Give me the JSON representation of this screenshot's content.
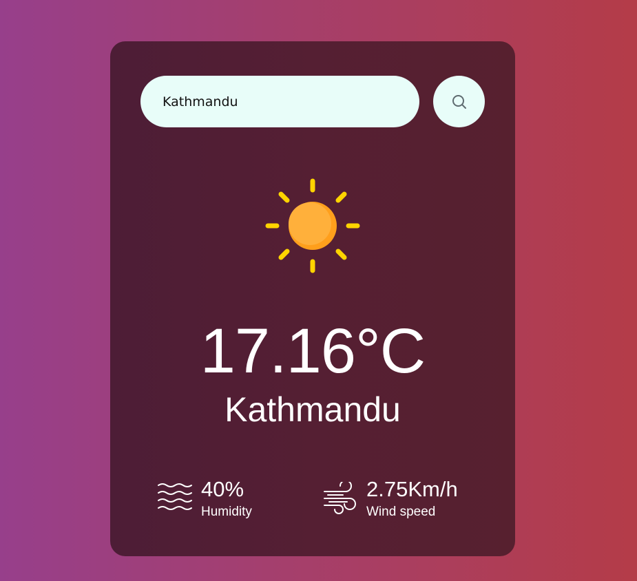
{
  "search": {
    "value": "Kathmandu",
    "button_icon": "search-icon"
  },
  "weather": {
    "icon": "clear-sun-icon",
    "temperature": "17.16°C",
    "city": "Kathmandu"
  },
  "details": {
    "humidity": {
      "icon": "humidity-waves-icon",
      "value": "40%",
      "label": "Humidity"
    },
    "wind": {
      "icon": "wind-icon",
      "value": "2.75Km/h",
      "label": "Wind speed"
    }
  },
  "colors": {
    "background_left": "#973f8b",
    "background_right": "#b43c48",
    "card": "#531f33",
    "input_background": "#e8fdf9",
    "sun_core": "#ffb03b",
    "sun_rays": "#ffd400"
  }
}
